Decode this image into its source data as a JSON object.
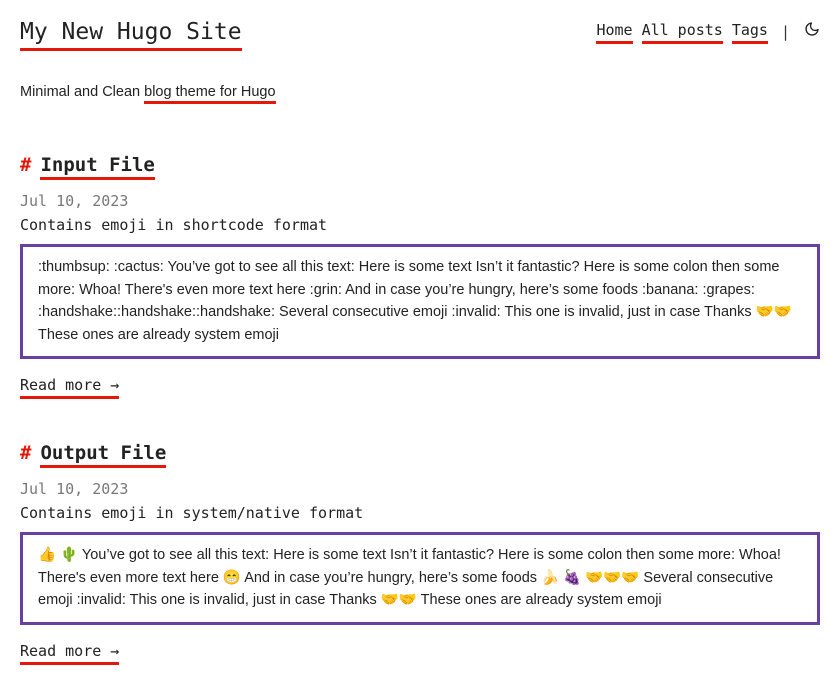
{
  "header": {
    "site_title": "My New Hugo Site",
    "nav": [
      {
        "label": "Home"
      },
      {
        "label": "All posts"
      },
      {
        "label": "Tags"
      }
    ],
    "separator": "|",
    "theme_toggle_icon": "moon-icon"
  },
  "tagline": {
    "prefix": "Minimal and Clean ",
    "link": "blog theme for Hugo"
  },
  "posts": [
    {
      "hash": "#",
      "title": "Input File",
      "date": "Jul 10, 2023",
      "description": "Contains emoji in shortcode format",
      "summary": ":thumbsup: :cactus: You’ve got to see all this text: Here is some text Isn’t it fantastic? Here is some colon then some more: Whoa! There's even more text here :grin: And in case you’re hungry, here’s some foods :banana: :grapes: :handshake::handshake::handshake: Several consecutive emoji :invalid: This one is invalid, just in case Thanks 🤝🤝 These ones are already system emoji",
      "read_more": "Read more →"
    },
    {
      "hash": "#",
      "title": "Output File",
      "date": "Jul 10, 2023",
      "description": "Contains emoji in system/native format",
      "summary": "👍 🌵 You’ve got to see all this text: Here is some text Isn’t it fantastic? Here is some colon then some more: Whoa! There's even more text here 😁 And in case you’re hungry, here’s some foods 🍌 🍇 🤝🤝🤝 Several consecutive emoji :invalid: This one is invalid, just in case Thanks 🤝🤝 These ones are already system emoji",
      "read_more": "Read more →"
    }
  ],
  "colors": {
    "accent_underline": "#e3170a",
    "summary_border": "#6b3fa0",
    "date_text": "#777777"
  }
}
